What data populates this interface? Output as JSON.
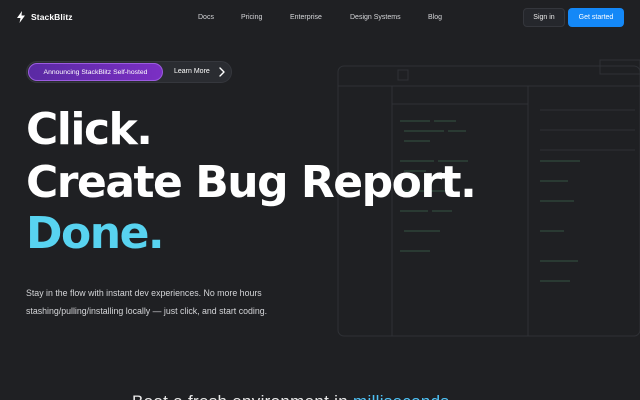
{
  "brand": {
    "name": "StackBlitz",
    "accent": "#1488f7",
    "highlight": "#58d3f0"
  },
  "nav": [
    {
      "label": "Docs"
    },
    {
      "label": "Pricing"
    },
    {
      "label": "Enterprise"
    },
    {
      "label": "Design Systems"
    },
    {
      "label": "Blog"
    }
  ],
  "header": {
    "signin_label": "Sign in",
    "get_started_label": "Get started"
  },
  "announcement": {
    "tag": "Announcing StackBlitz Self-hosted",
    "link": "Learn More",
    "icon": "chevron-right-icon"
  },
  "hero": {
    "line1": "Click.",
    "line2": "Create Bug Report.",
    "line3": "Done.",
    "subtitle_line1": "Stay in the flow with instant dev experiences. No more hours",
    "subtitle_line2": "stashing/pulling/installing locally — just click, and start coding."
  },
  "teaser": {
    "text": "Boot a fresh environment in ",
    "highlight": "milliseconds."
  }
}
